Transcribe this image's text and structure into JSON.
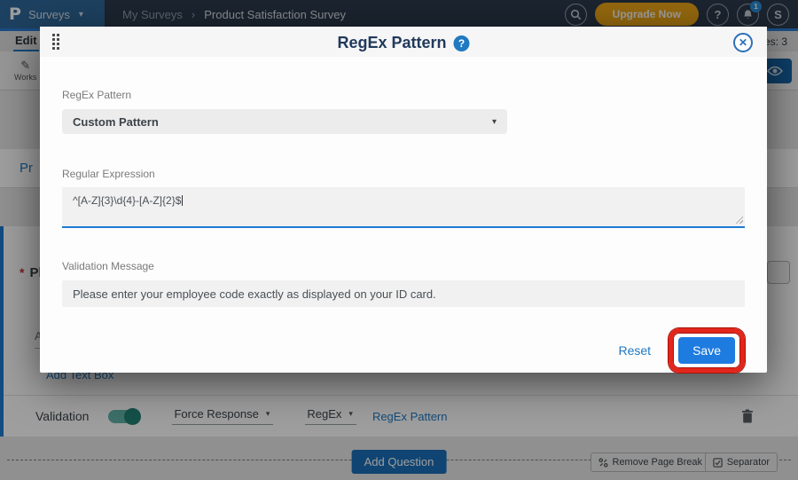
{
  "navbar": {
    "logo_letter": "P",
    "product_menu_label": "Surveys",
    "breadcrumb_parent": "My Surveys",
    "breadcrumb_separator": "›",
    "breadcrumb_current": "Product Satisfaction Survey",
    "upgrade_label": "Upgrade Now",
    "help_glyph": "?",
    "notification_count": "1",
    "avatar_initial": "S"
  },
  "tabbar": {
    "edit_label": "Edit",
    "responses_count_partial": "es: 3"
  },
  "toolbar": {
    "workspace_label_partial": "Works"
  },
  "canvas": {
    "survey_title_partial": "Pr",
    "required_marker": "*",
    "question_text_partial": "Pl",
    "answer_label_partial": "Ar",
    "add_text_box_label": "Add Text Box",
    "validation_label": "Validation",
    "force_response_label": "Force Response",
    "regex_dropdown_label": "RegEx",
    "regex_pattern_link_label": "RegEx Pattern"
  },
  "footer": {
    "add_question_label": "Add Question",
    "remove_page_break_label": "Remove Page Break",
    "separator_label": "Separator"
  },
  "modal": {
    "title": "RegEx Pattern",
    "help_glyph": "?",
    "close_glyph": "✕",
    "pattern_label": "RegEx Pattern",
    "pattern_selected": "Custom Pattern",
    "expression_label": "Regular Expression",
    "expression_value": "^[A-Z]{3}\\d{4}-[A-Z]{2}$",
    "message_label": "Validation Message",
    "message_value": "Please enter your employee code exactly as displayed on your ID card.",
    "reset_label": "Reset",
    "save_label": "Save"
  },
  "colors": {
    "accent_blue": "#2079c3",
    "save_blue": "#1e7be0",
    "annotation_red": "#e2261c",
    "upgrade_gold": "#efa817",
    "toggle_teal": "#218377"
  }
}
